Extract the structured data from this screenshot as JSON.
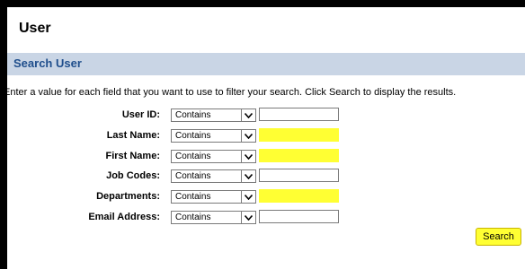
{
  "page": {
    "title": "User"
  },
  "section": {
    "title": "Search User"
  },
  "instructions": "Enter a value for each field that you want to use to filter your search. Click Search to display the results.",
  "fields": [
    {
      "label": "User ID:",
      "operator": "Contains",
      "value": "",
      "highlighted": false
    },
    {
      "label": "Last Name:",
      "operator": "Contains",
      "value": "",
      "highlighted": true
    },
    {
      "label": "First Name:",
      "operator": "Contains",
      "value": "",
      "highlighted": true
    },
    {
      "label": "Job Codes:",
      "operator": "Contains",
      "value": "",
      "highlighted": false
    },
    {
      "label": "Departments:",
      "operator": "Contains",
      "value": "",
      "highlighted": true
    },
    {
      "label": "Email Address:",
      "operator": "Contains",
      "value": "",
      "highlighted": false
    }
  ],
  "search_button": {
    "label": "Search"
  },
  "colors": {
    "highlight": "#ffff33",
    "section_header_bg": "#c9d5e5",
    "section_title": "#1f4e8c"
  },
  "icons": {
    "select_arrow": "chevron-down-icon"
  }
}
